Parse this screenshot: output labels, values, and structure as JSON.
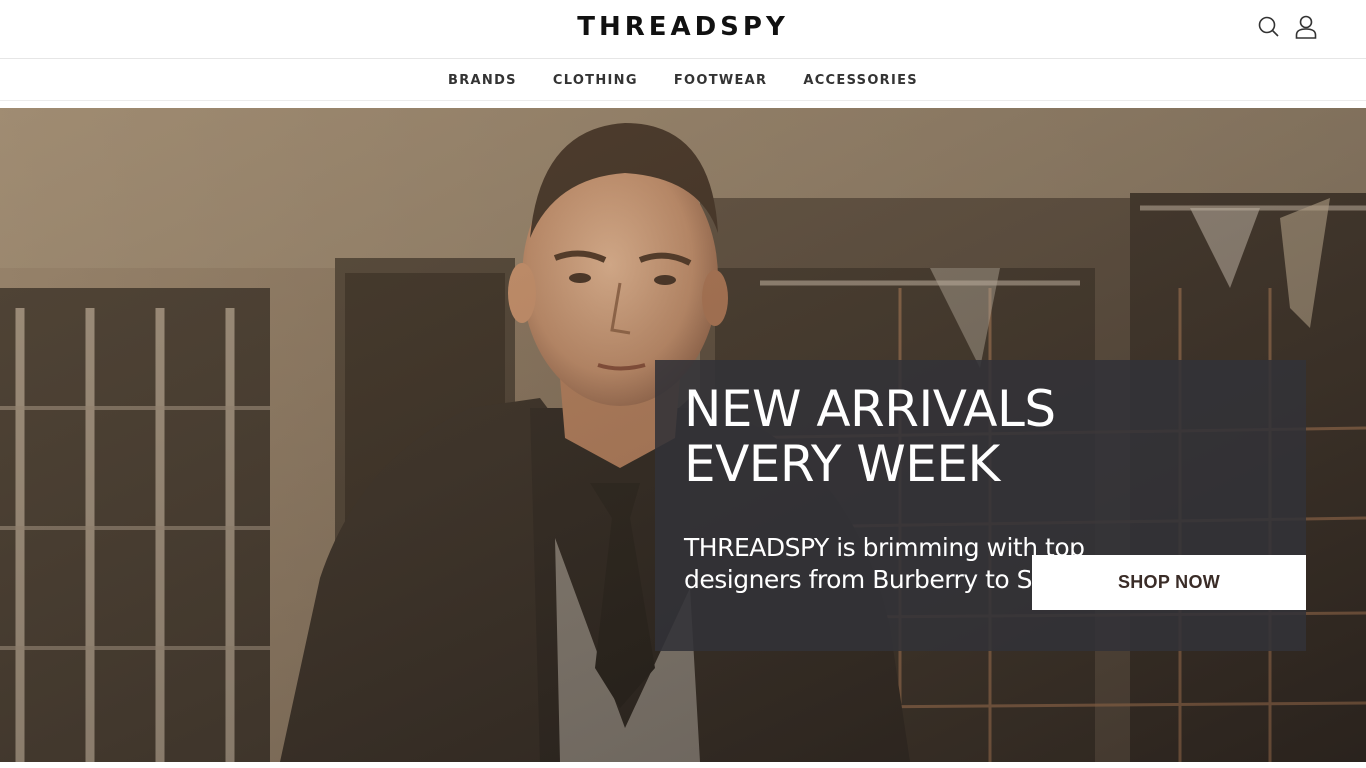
{
  "brand": {
    "logo": "THREADSPY"
  },
  "header": {
    "icons": [
      "search-icon",
      "user-icon"
    ]
  },
  "nav": {
    "items": [
      {
        "label": "BRANDS"
      },
      {
        "label": "CLOTHING"
      },
      {
        "label": "FOOTWEAR"
      },
      {
        "label": "ACCESSORIES"
      }
    ]
  },
  "hero": {
    "title_line1": "NEW ARRIVALS",
    "title_line2": "EVERY WEEK",
    "subtitle_line1": "THREADSPY is brimming with top",
    "subtitle_line2": "designers from Burberry to Stone Island",
    "cta": "SHOP NOW"
  },
  "colors": {
    "panel": "#323238",
    "cta_text": "#3a2c27",
    "nav_text": "#333333"
  }
}
